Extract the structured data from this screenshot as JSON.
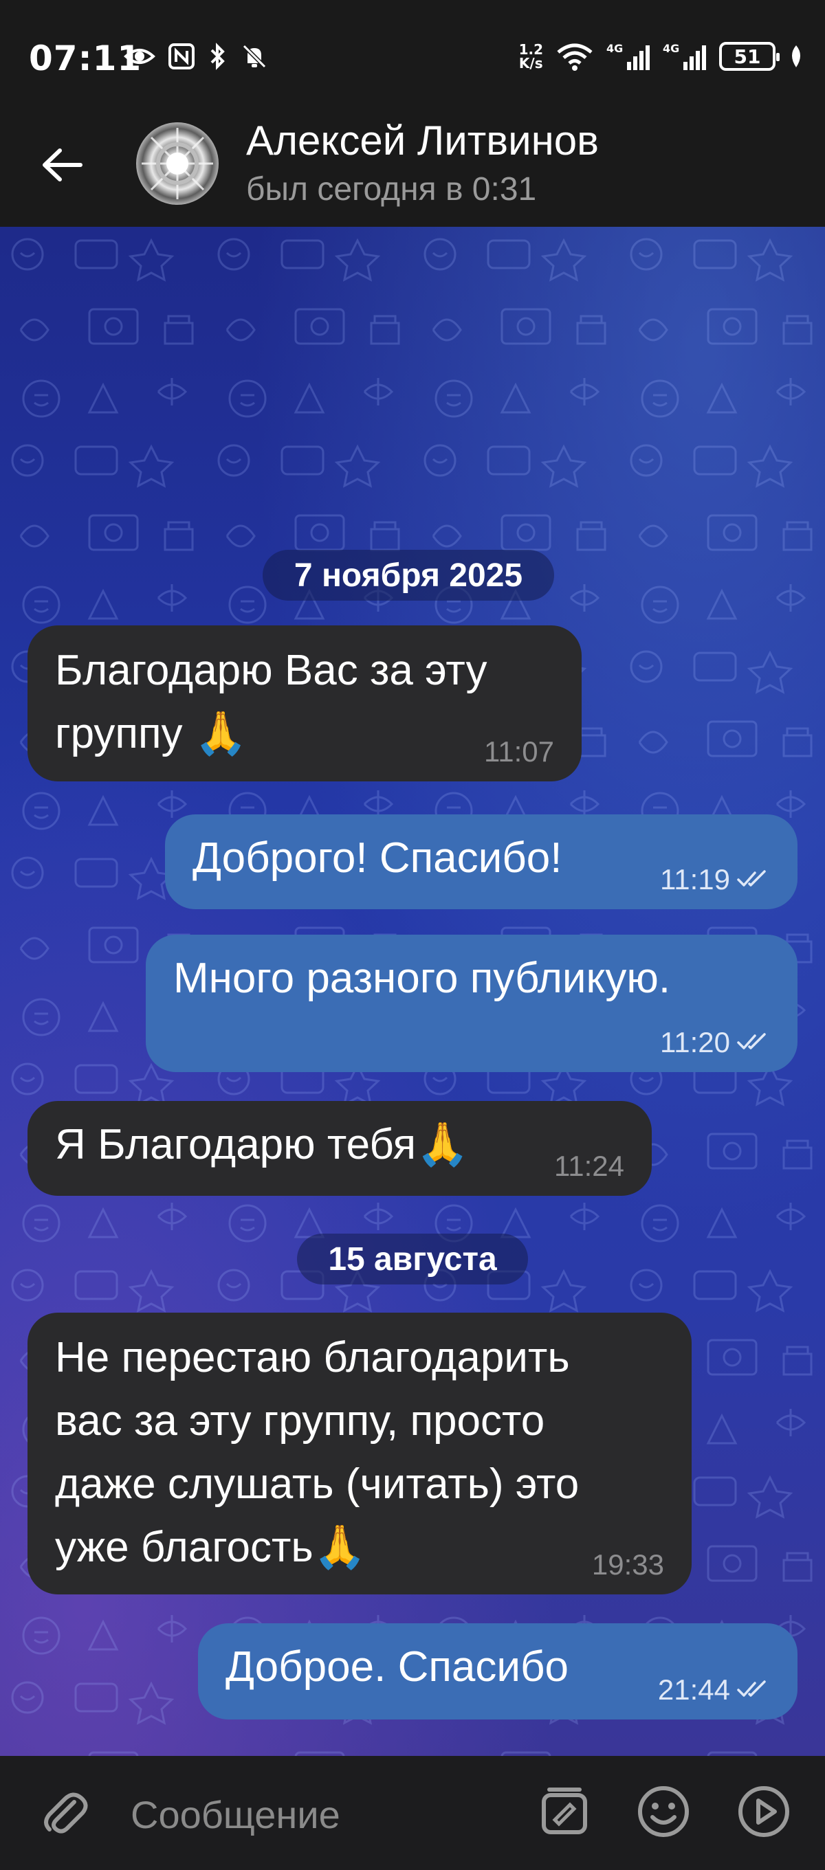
{
  "status_bar": {
    "time": "07:11",
    "net_speed_value": "1.2",
    "net_speed_unit": "K/s",
    "battery": "51",
    "signal_label_1": "4G",
    "signal_label_2": "4G",
    "wifi_label": "6"
  },
  "header": {
    "contact_name": "Алексей Литвинов",
    "contact_status": "был сегодня в 0:31"
  },
  "messages": [
    {
      "type": "date",
      "text": "7 ноября 2025"
    },
    {
      "type": "in",
      "text": "Благодарю Вас за эту\nгруппу 🙏",
      "time": "11:07"
    },
    {
      "type": "out",
      "text": "Доброго! Спасибо!",
      "time": "11:19",
      "read": true
    },
    {
      "type": "out",
      "text": "Много разного публикую.",
      "time": "11:20",
      "read": true
    },
    {
      "type": "in",
      "text": "Я Благодарю тебя🙏",
      "time": "11:24"
    },
    {
      "type": "date",
      "text": "15 августа"
    },
    {
      "type": "in",
      "text": "Не перестаю благодарить\nвас за эту группу, просто\nдаже слушать (читать) это\nуже благость🙏",
      "time": "19:33"
    },
    {
      "type": "out",
      "text": "Доброе. Спасибо",
      "time": "21:44",
      "read": true
    }
  ],
  "input": {
    "placeholder": "Сообщение"
  },
  "colors": {
    "incoming_bubble": "#2a2a2c",
    "outgoing_bubble": "#3b6db5",
    "header_bg": "#1a1a1a"
  },
  "icons": {
    "back": "arrow-left-icon",
    "attach": "paperclip-icon",
    "sticker": "sticker-icon",
    "emoji": "smile-icon",
    "voice": "play-circle-icon"
  }
}
